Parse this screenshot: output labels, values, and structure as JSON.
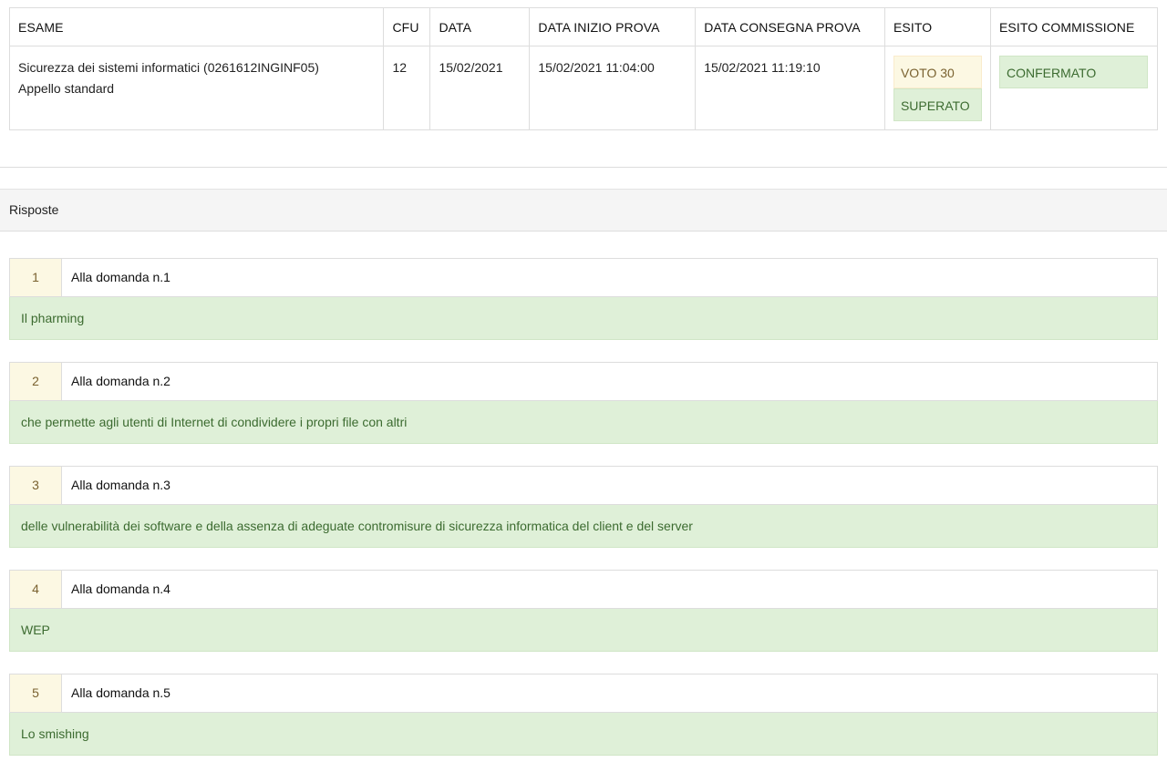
{
  "exam_table": {
    "headers": {
      "esame": "ESAME",
      "cfu": "CFU",
      "data": "DATA",
      "data_inizio": "DATA INIZIO PROVA",
      "data_consegna": "DATA CONSEGNA PROVA",
      "esito": "ESITO",
      "esito_commissione": "ESITO COMMISSIONE"
    },
    "row": {
      "esame_name": "Sicurezza dei sistemi informatici (0261612INGINF05)",
      "esame_type": "Appello standard",
      "cfu": "12",
      "data": "15/02/2021",
      "data_inizio": "15/02/2021 11:04:00",
      "data_consegna": "15/02/2021 11:19:10",
      "esito_voto": "VOTO 30",
      "esito_stato": "SUPERATO",
      "esito_commissione": "CONFERMATO"
    }
  },
  "section": {
    "title": "Risposte"
  },
  "answers": [
    {
      "number": "1",
      "question": "Alla domanda n.1",
      "answer": "Il pharming"
    },
    {
      "number": "2",
      "question": "Alla domanda n.2",
      "answer": "che permette agli utenti di Internet di condividere i propri file con altri"
    },
    {
      "number": "3",
      "question": "Alla domanda n.3",
      "answer": "delle vulnerabilità dei software e della assenza di adeguate contromisure di sicurezza informatica del client e del server"
    },
    {
      "number": "4",
      "question": "Alla domanda n.4",
      "answer": "WEP"
    },
    {
      "number": "5",
      "question": "Alla domanda n.5",
      "answer": "Lo smishing"
    }
  ],
  "colors": {
    "success_bg": "#dff0d8",
    "warning_bg": "#fcf8e3",
    "success_text": "#3c6b30",
    "warning_text": "#7a6230"
  }
}
